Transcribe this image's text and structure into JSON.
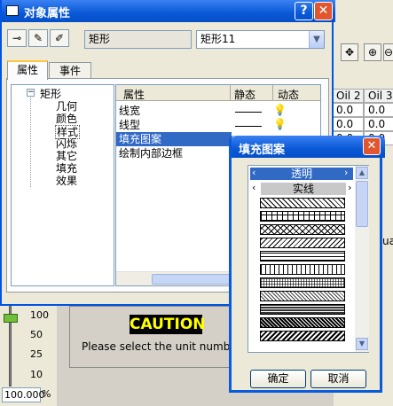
{
  "background": {
    "grid_headers": [
      "Oil 2",
      "Oil 3"
    ],
    "grid_values": [
      "0.0",
      "0.0",
      "0.0",
      "0.0",
      "0.0",
      "0.0"
    ],
    "side_text": "ua",
    "slider_ticks": [
      "100",
      "50",
      "25",
      "10"
    ],
    "zoom_value": "100.000",
    "zoom_unit": "%",
    "caution_label": "CAUTION",
    "caution_message": "Please select the unit numbe"
  },
  "dialog": {
    "title": "对象属性",
    "object_type": "矩形",
    "object_name": "矩形11",
    "tabs": [
      "属性",
      "事件"
    ],
    "tree_root": "矩形",
    "tree_children": [
      "几何",
      "颜色",
      "样式",
      "闪烁",
      "其它",
      "填充",
      "效果"
    ],
    "columns": [
      "属性",
      "静态",
      "动态"
    ],
    "rows": [
      "线宽",
      "线型",
      "填充图案",
      "绘制内部边框"
    ]
  },
  "popup": {
    "title": "填充图案",
    "selected": "透明",
    "second": "实线",
    "ok_label": "确定",
    "cancel_label": "取消"
  },
  "colors": {
    "titlebar": "#0a58d6",
    "selection": "#316ac5",
    "caution_bg": "#000000",
    "caution_text": "#ffff00"
  }
}
